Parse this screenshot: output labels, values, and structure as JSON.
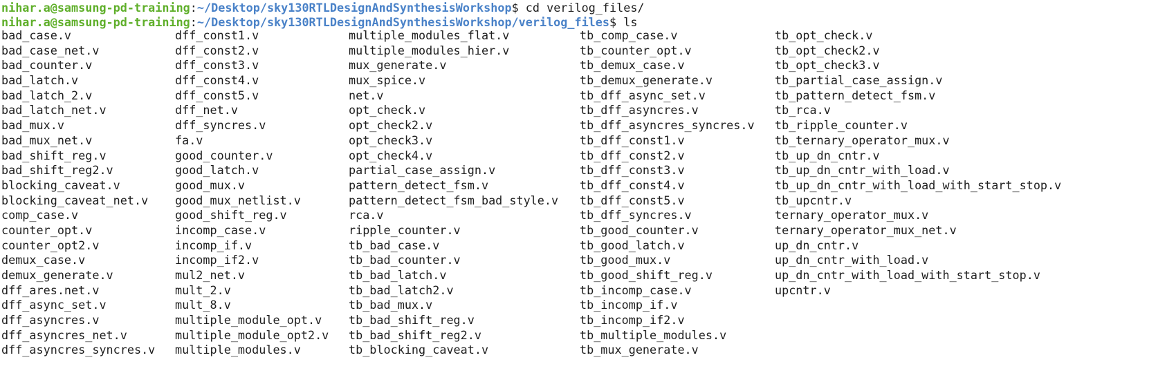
{
  "prompt_lines": [
    {
      "user_host": "nihar.a@samsung-pd-training",
      "sep": ":",
      "path": "~/Desktop/sky130RTLDesignAndSynthesisWorkshop",
      "symbol": "$",
      "command": " cd verilog_files/"
    },
    {
      "user_host": "nihar.a@samsung-pd-training",
      "sep": ":",
      "path": "~/Desktop/sky130RTLDesignAndSynthesisWorkshop/verilog_files",
      "symbol": "$",
      "command": " ls"
    }
  ],
  "ls_columns": [
    [
      "bad_case.v",
      "bad_case_net.v",
      "bad_counter.v",
      "bad_latch.v",
      "bad_latch_2.v",
      "bad_latch_net.v",
      "bad_mux.v",
      "bad_mux_net.v",
      "bad_shift_reg.v",
      "bad_shift_reg2.v",
      "blocking_caveat.v",
      "blocking_caveat_net.v",
      "comp_case.v",
      "counter_opt.v",
      "counter_opt2.v",
      "demux_case.v",
      "demux_generate.v",
      "dff_ares.net.v",
      "dff_async_set.v",
      "dff_asyncres.v",
      "dff_asyncres_net.v",
      "dff_asyncres_syncres.v"
    ],
    [
      "dff_const1.v",
      "dff_const2.v",
      "dff_const3.v",
      "dff_const4.v",
      "dff_const5.v",
      "dff_net.v",
      "dff_syncres.v",
      "fa.v",
      "good_counter.v",
      "good_latch.v",
      "good_mux.v",
      "good_mux_netlist.v",
      "good_shift_reg.v",
      "incomp_case.v",
      "incomp_if.v",
      "incomp_if2.v",
      "mul2_net.v",
      "mult_2.v",
      "mult_8.v",
      "multiple_module_opt.v",
      "multiple_module_opt2.v",
      "multiple_modules.v"
    ],
    [
      "multiple_modules_flat.v",
      "multiple_modules_hier.v",
      "mux_generate.v",
      "mux_spice.v",
      "net.v",
      "opt_check.v",
      "opt_check2.v",
      "opt_check3.v",
      "opt_check4.v",
      "partial_case_assign.v",
      "pattern_detect_fsm.v",
      "pattern_detect_fsm_bad_style.v",
      "rca.v",
      "ripple_counter.v",
      "tb_bad_case.v",
      "tb_bad_counter.v",
      "tb_bad_latch.v",
      "tb_bad_latch2.v",
      "tb_bad_mux.v",
      "tb_bad_shift_reg.v",
      "tb_bad_shift_reg2.v",
      "tb_blocking_caveat.v"
    ],
    [
      "tb_comp_case.v",
      "tb_counter_opt.v",
      "tb_demux_case.v",
      "tb_demux_generate.v",
      "tb_dff_async_set.v",
      "tb_dff_asyncres.v",
      "tb_dff_asyncres_syncres.v",
      "tb_dff_const1.v",
      "tb_dff_const2.v",
      "tb_dff_const3.v",
      "tb_dff_const4.v",
      "tb_dff_const5.v",
      "tb_dff_syncres.v",
      "tb_good_counter.v",
      "tb_good_latch.v",
      "tb_good_mux.v",
      "tb_good_shift_reg.v",
      "tb_incomp_case.v",
      "tb_incomp_if.v",
      "tb_incomp_if2.v",
      "tb_multiple_modules.v",
      "tb_mux_generate.v"
    ],
    [
      "tb_opt_check.v",
      "tb_opt_check2.v",
      "tb_opt_check3.v",
      "tb_partial_case_assign.v",
      "tb_pattern_detect_fsm.v",
      "tb_rca.v",
      "tb_ripple_counter.v",
      "tb_ternary_operator_mux.v",
      "tb_up_dn_cntr.v",
      "tb_up_dn_cntr_with_load.v",
      "tb_up_dn_cntr_with_load_with_start_stop.v",
      "tb_upcntr.v",
      "ternary_operator_mux.v",
      "ternary_operator_mux_net.v",
      "up_dn_cntr.v",
      "up_dn_cntr_with_load.v",
      "up_dn_cntr_with_load_with_start_stop.v",
      "upcntr.v"
    ]
  ],
  "colors": {
    "background": "#ffffff",
    "text": "#1e1e1e",
    "user_host": "#5faf2a",
    "path": "#4a82c8"
  }
}
